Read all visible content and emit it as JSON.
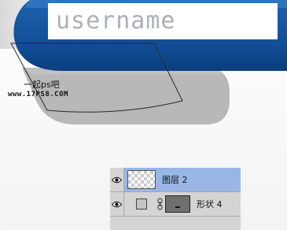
{
  "canvas": {
    "username_text": "username",
    "watermark": {
      "chinese": "一起ps吧",
      "url": "www.17PS8.COM"
    },
    "colors": {
      "blue_band_dark": "#104f9a",
      "blue_band_light": "#2f7ec6",
      "shadow_gray": "#b9b9b9",
      "background": "#ffffff"
    }
  },
  "layers_panel": {
    "layers": [
      {
        "name": "图层 2",
        "visible": true,
        "selected": true,
        "thumbnail": "transparent-checker",
        "eye_icon": "eye-icon"
      },
      {
        "name": "形状 4",
        "visible": true,
        "selected": false,
        "thumbnail": "gray-shape-mask",
        "eye_icon": "eye-icon",
        "link_icon": "chain-link-icon",
        "fill_swatch_color": "#c4c4c4"
      }
    ]
  }
}
